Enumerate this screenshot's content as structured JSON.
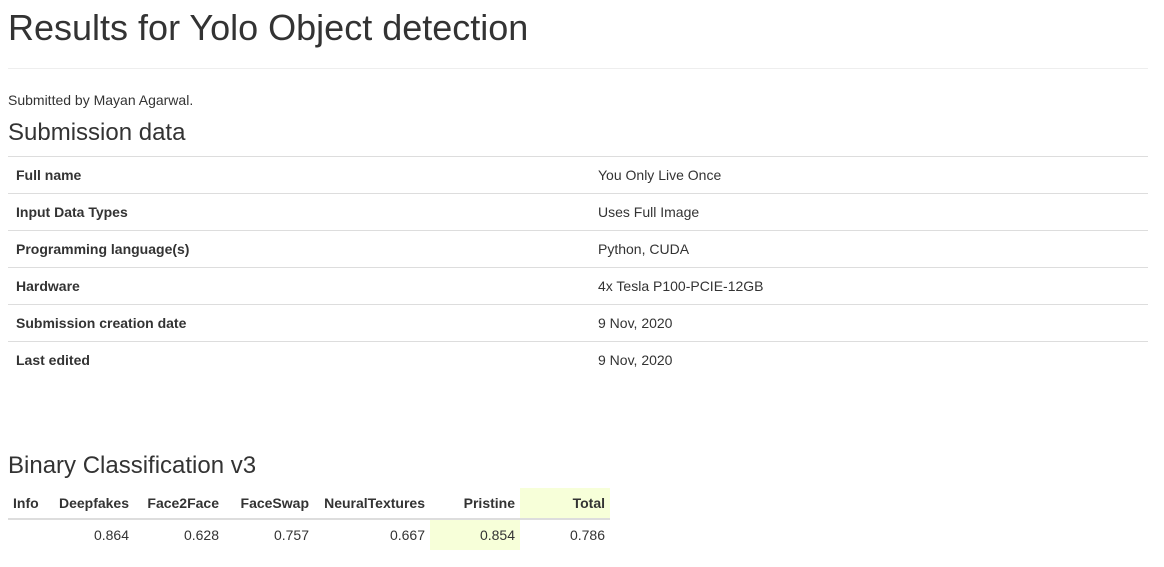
{
  "page": {
    "title": "Results for Yolo Object detection",
    "submitted_by": "Submitted by Mayan Agarwal."
  },
  "submission": {
    "heading": "Submission data",
    "rows": [
      {
        "label": "Full name",
        "value": "You Only Live Once"
      },
      {
        "label": "Input Data Types",
        "value": "Uses Full Image"
      },
      {
        "label": "Programming language(s)",
        "value": "Python, CUDA"
      },
      {
        "label": "Hardware",
        "value": "4x Tesla P100-PCIE-12GB"
      },
      {
        "label": "Submission creation date",
        "value": "9 Nov, 2020"
      },
      {
        "label": "Last edited",
        "value": "9 Nov, 2020"
      }
    ]
  },
  "binary": {
    "heading": "Binary Classification v3",
    "columns": [
      "Info",
      "Deepfakes",
      "Face2Face",
      "FaceSwap",
      "NeuralTextures",
      "Pristine",
      "Total"
    ],
    "row": [
      "",
      "0.864",
      "0.628",
      "0.757",
      "0.667",
      "0.854",
      "0.786"
    ],
    "highlight_color": "#f7ffd9"
  }
}
